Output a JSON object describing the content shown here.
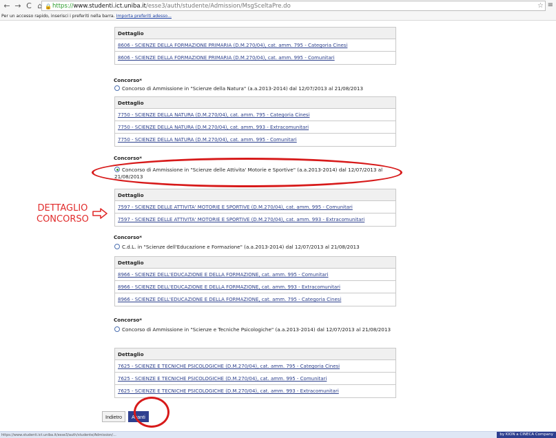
{
  "browser": {
    "url_https": "https://",
    "url_host": "www.studenti.ict.uniba.it",
    "url_path": "/esse3/auth/studente/Admission/MsgSceltaPre.do",
    "bookmark_prompt": "Per un accesso rapido, inserisci i preferiti nella barra.",
    "import_link": "Importa preferiti adesso..."
  },
  "groups": [
    {
      "concorso_label": "",
      "radio_text": "",
      "header": "Dettaglio",
      "rows": [
        "8606 - SCIENZE DELLA FORMAZIONE PRIMARIA (D.M.270/04), cat. amm. 795 - Categoria Cinesi",
        "8606 - SCIENZE DELLA FORMAZIONE PRIMARIA (D.M.270/04), cat. amm. 995 - Comunitari"
      ]
    },
    {
      "concorso_label": "Concorso*",
      "radio_text": "Concorso di Ammissione in \"Scienze della Natura\" (a.a.2013-2014) dal 12/07/2013 al 21/08/2013",
      "header": "Dettaglio",
      "rows": [
        "7750 - SCIENZE DELLA NATURA (D.M.270/04), cat. amm. 795 - Categoria Cinesi",
        "7750 - SCIENZE DELLA NATURA (D.M.270/04), cat. amm. 993 - Extracomunitari",
        "7750 - SCIENZE DELLA NATURA (D.M.270/04), cat. amm. 995 - Comunitari"
      ]
    },
    {
      "concorso_label": "Concorso*",
      "radio_text": "Concorso di Ammissione in \"Scienze delle Attivita' Motorie e Sportive\" (a.a.2013-2014) dal 12/07/2013 al 21/08/2013",
      "header": "Dettaglio",
      "rows": [
        "7597 - SCIENZE DELLE ATTIVITA' MOTORIE E SPORTIVE (D.M.270/04), cat. amm. 995 - Comunitari",
        "7597 - SCIENZE DELLE ATTIVITA' MOTORIE E SPORTIVE (D.M.270/04), cat. amm. 993 - Extracomunitari"
      ]
    },
    {
      "concorso_label": "Concorso*",
      "radio_text": "C.d.L. in \"Scienze dell'Educazione e Formazione\" (a.a.2013-2014) dal 12/07/2013 al 21/08/2013",
      "header": "Dettaglio",
      "rows": [
        "8966 - SCIENZE DELL'EDUCAZIONE E DELLA FORMAZIONE, cat. amm. 995 - Comunitari",
        "8966 - SCIENZE DELL'EDUCAZIONE E DELLA FORMAZIONE, cat. amm. 993 - Extracomunitari",
        "8966 - SCIENZE DELL'EDUCAZIONE E DELLA FORMAZIONE, cat. amm. 795 - Categoria Cinesi"
      ]
    },
    {
      "concorso_label": "Concorso*",
      "radio_text": "Concorso di Ammissione in \"Scienze e Tecniche Psicologiche\" (a.a.2013-2014) dal 12/07/2013 al 21/08/2013",
      "header": "Dettaglio",
      "rows": [
        "7625 - SCIENZE E TECNICHE PSICOLOGICHE (D.M.270/04), cat. amm. 795 - Categoria Cinesi",
        "7625 - SCIENZE E TECNICHE PSICOLOGICHE (D.M.270/04), cat. amm. 995 - Comunitari",
        "7625 - SCIENZE E TECNICHE PSICOLOGICHE (D.M.270/04), cat. amm. 993 - Extracomunitari"
      ]
    }
  ],
  "buttons": {
    "back": "Indietro",
    "next": "Avanti"
  },
  "annotation": {
    "line1": "DETTAGLIO",
    "line2": "CONCORSO"
  },
  "status": {
    "url": "https://www.studenti.ict.uniba.it/esse3/auth/studente/Admission/...",
    "badge": "by KION a CINECA Company"
  },
  "colors": {
    "link": "#2b3f8c",
    "annotation": "#e12b2b",
    "primary_button": "#2e3f8f"
  }
}
